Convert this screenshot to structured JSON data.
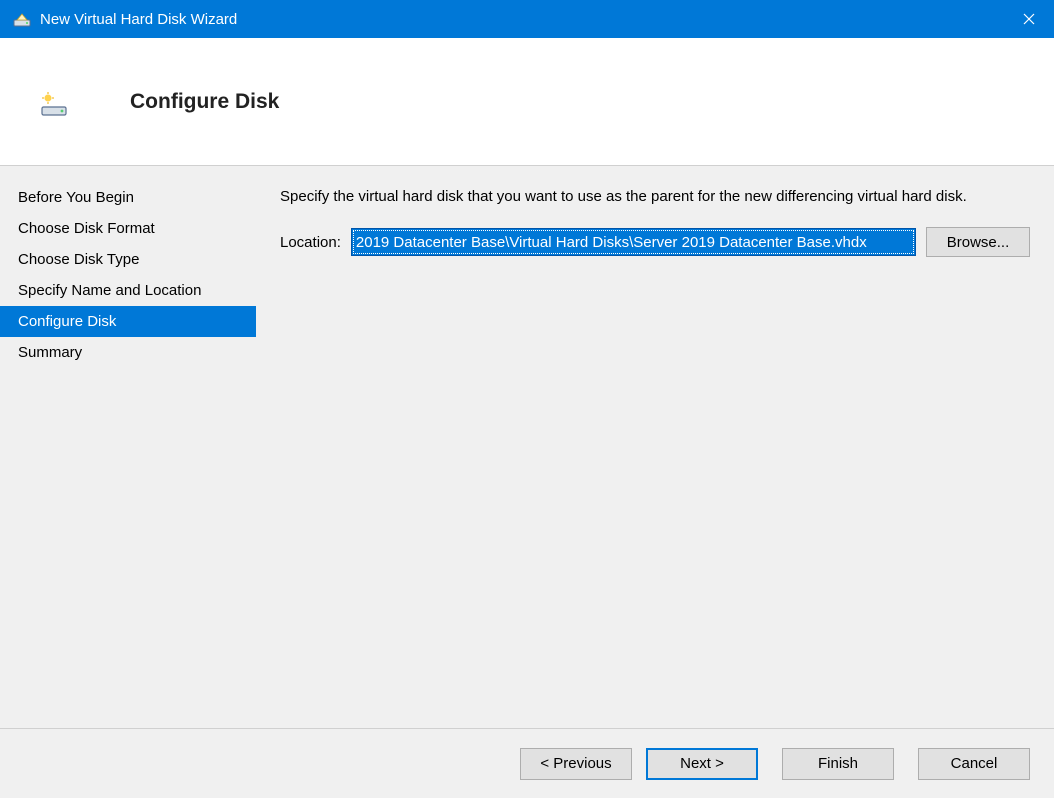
{
  "window": {
    "title": "New Virtual Hard Disk Wizard"
  },
  "header": {
    "title": "Configure Disk"
  },
  "sidebar": {
    "steps": [
      {
        "label": "Before You Begin",
        "active": false
      },
      {
        "label": "Choose Disk Format",
        "active": false
      },
      {
        "label": "Choose Disk Type",
        "active": false
      },
      {
        "label": "Specify Name and Location",
        "active": false
      },
      {
        "label": "Configure Disk",
        "active": true
      },
      {
        "label": "Summary",
        "active": false
      }
    ]
  },
  "content": {
    "instruction": "Specify the virtual hard disk that you want to use as the parent for the new differencing virtual hard disk.",
    "location_label": "Location:",
    "location_value": "2019 Datacenter Base\\Virtual Hard Disks\\Server 2019 Datacenter Base.vhdx",
    "browse_label": "Browse..."
  },
  "footer": {
    "previous": "< Previous",
    "next": "Next >",
    "finish": "Finish",
    "cancel": "Cancel"
  }
}
